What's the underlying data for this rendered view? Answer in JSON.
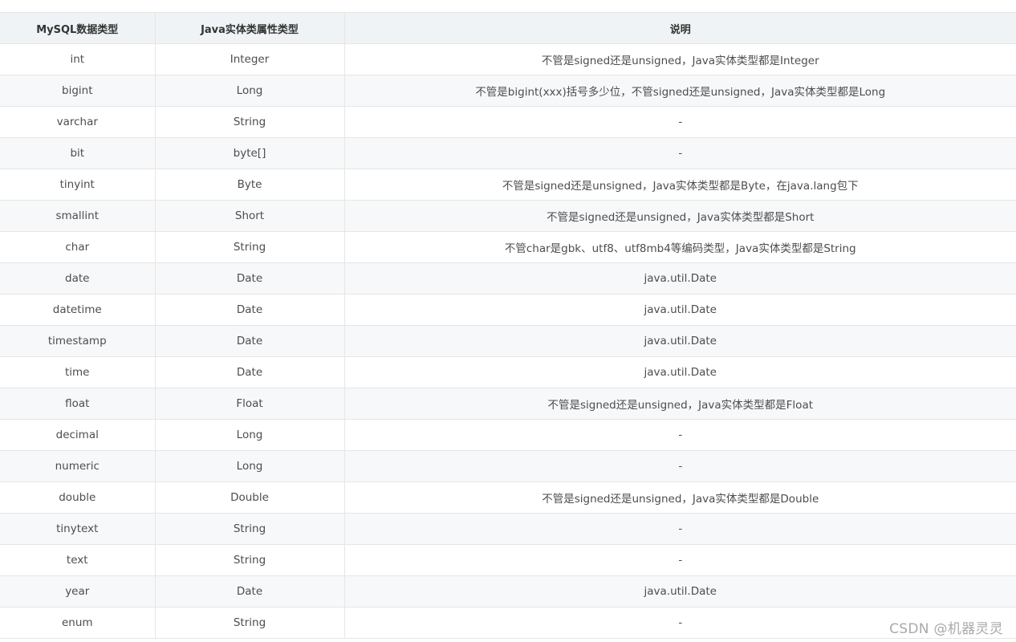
{
  "table": {
    "headers": [
      "MySQL数据类型",
      "Java实体类属性类型",
      "说明"
    ],
    "rows": [
      [
        "int",
        "Integer",
        "不管是signed还是unsigned，Java实体类型都是Integer"
      ],
      [
        "bigint",
        "Long",
        "不管是bigint(xxx)括号多少位，不管signed还是unsigned，Java实体类型都是Long"
      ],
      [
        "varchar",
        "String",
        "-"
      ],
      [
        "bit",
        "byte[]",
        "-"
      ],
      [
        "tinyint",
        "Byte",
        "不管是signed还是unsigned，Java实体类型都是Byte，在java.lang包下"
      ],
      [
        "smallint",
        "Short",
        "不管是signed还是unsigned，Java实体类型都是Short"
      ],
      [
        "char",
        "String",
        "不管char是gbk、utf8、utf8mb4等编码类型，Java实体类型都是String"
      ],
      [
        "date",
        "Date",
        "java.util.Date"
      ],
      [
        "datetime",
        "Date",
        "java.util.Date"
      ],
      [
        "timestamp",
        "Date",
        "java.util.Date"
      ],
      [
        "time",
        "Date",
        "java.util.Date"
      ],
      [
        "float",
        "Float",
        "不管是signed还是unsigned，Java实体类型都是Float"
      ],
      [
        "decimal",
        "Long",
        "-"
      ],
      [
        "numeric",
        "Long",
        "-"
      ],
      [
        "double",
        "Double",
        "不管是signed还是unsigned，Java实体类型都是Double"
      ],
      [
        "tinytext",
        "String",
        "-"
      ],
      [
        "text",
        "String",
        "-"
      ],
      [
        "year",
        "Date",
        "java.util.Date"
      ],
      [
        "enum",
        "String",
        "-"
      ]
    ]
  },
  "watermark": "CSDN @机器灵灵"
}
